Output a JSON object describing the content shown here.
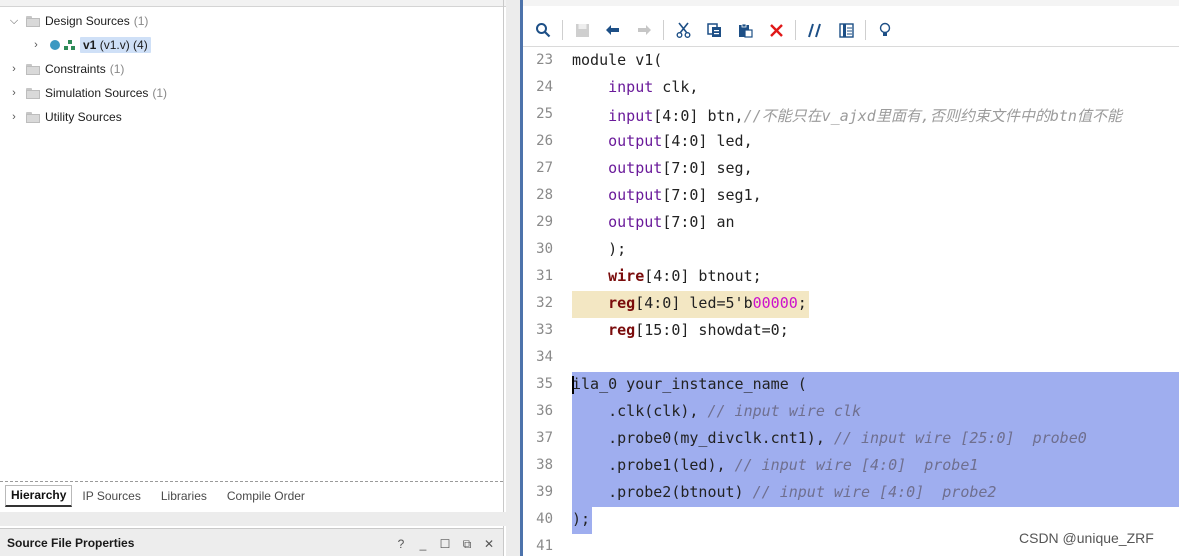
{
  "left_panel": {
    "tree": [
      {
        "label": "Design Sources",
        "count": "(1)",
        "expanded": true
      },
      {
        "label": "v1",
        "detail": "(v1.v) (4)",
        "child": true
      },
      {
        "label": "Constraints",
        "count": "(1)"
      },
      {
        "label": "Simulation Sources",
        "count": "(1)"
      },
      {
        "label": "Utility Sources",
        "count": ""
      }
    ],
    "tabs": [
      "Hierarchy",
      "IP Sources",
      "Libraries",
      "Compile Order"
    ],
    "active_tab": "Hierarchy",
    "properties_title": "Source File Properties",
    "controls": [
      "?",
      "_",
      "☐",
      "⧉",
      "✕"
    ]
  },
  "toolbar": {
    "icons": [
      "search-icon",
      "save-icon",
      "undo-icon",
      "redo-icon",
      "cut-icon",
      "copy-icon",
      "paste-icon",
      "delete-icon",
      "comment-icon",
      "column-icon",
      "bulb-icon"
    ]
  },
  "editor": {
    "lines": [
      {
        "n": "23",
        "segs": [
          [
            "pl",
            "module v1("
          ]
        ]
      },
      {
        "n": "24",
        "segs": [
          [
            "pl",
            "    "
          ],
          [
            "kw",
            "input"
          ],
          [
            "pl",
            " clk,"
          ]
        ]
      },
      {
        "n": "25",
        "segs": [
          [
            "pl",
            "    "
          ],
          [
            "kw",
            "input"
          ],
          [
            "pl",
            "[4:0] btn,"
          ],
          [
            "cmt",
            "//不能只在v_ajxd里面有,否则约束文件中的btn值不能"
          ]
        ]
      },
      {
        "n": "26",
        "segs": [
          [
            "pl",
            "    "
          ],
          [
            "kw",
            "output"
          ],
          [
            "pl",
            "[4:0] led,"
          ]
        ]
      },
      {
        "n": "27",
        "segs": [
          [
            "pl",
            "    "
          ],
          [
            "kw",
            "output"
          ],
          [
            "pl",
            "[7:0] seg,"
          ]
        ]
      },
      {
        "n": "28",
        "segs": [
          [
            "pl",
            "    "
          ],
          [
            "kw",
            "output"
          ],
          [
            "pl",
            "[7:0] seg1,"
          ]
        ]
      },
      {
        "n": "29",
        "segs": [
          [
            "pl",
            "    "
          ],
          [
            "kw",
            "output"
          ],
          [
            "pl",
            "[7:0] an"
          ]
        ]
      },
      {
        "n": "30",
        "segs": [
          [
            "pl",
            "    );"
          ]
        ]
      },
      {
        "n": "31",
        "segs": [
          [
            "pl",
            "    "
          ],
          [
            "kwb",
            "wire"
          ],
          [
            "pl",
            "[4:0] btnout;"
          ]
        ]
      },
      {
        "n": "32",
        "hl": "current",
        "segs": [
          [
            "pl",
            "    "
          ],
          [
            "kwb",
            "reg"
          ],
          [
            "pl",
            "[4:0] led=5'b"
          ],
          [
            "num",
            "00000"
          ],
          [
            "pl",
            ";"
          ]
        ]
      },
      {
        "n": "33",
        "segs": [
          [
            "pl",
            "    "
          ],
          [
            "kwb",
            "reg"
          ],
          [
            "pl",
            "[15:0] showdat=0;"
          ]
        ]
      },
      {
        "n": "34",
        "segs": []
      },
      {
        "n": "35",
        "hl": "selected",
        "caret": true,
        "segs": [
          [
            "pl",
            "ila_0 your_instance_name ("
          ]
        ]
      },
      {
        "n": "36",
        "hl": "selected",
        "segs": [
          [
            "pl",
            "    .clk(clk), "
          ],
          [
            "sel-cmt",
            "// input wire clk"
          ]
        ]
      },
      {
        "n": "37",
        "hl": "selected",
        "segs": [
          [
            "pl",
            "    .probe0(my_divclk.cnt1), "
          ],
          [
            "sel-cmt",
            "// input wire [25:0]  probe0"
          ]
        ]
      },
      {
        "n": "38",
        "hl": "selected",
        "segs": [
          [
            "pl",
            "    .probe1(led), "
          ],
          [
            "sel-cmt",
            "// input wire [4:0]  probe1"
          ]
        ]
      },
      {
        "n": "39",
        "hl": "selected",
        "segs": [
          [
            "pl",
            "    .probe2(btnout) "
          ],
          [
            "sel-cmt",
            "// input wire [4:0]  probe2"
          ]
        ]
      },
      {
        "n": "40",
        "hl": "selected-last",
        "segs": [
          [
            "pl",
            ");"
          ]
        ]
      },
      {
        "n": "41",
        "segs": []
      }
    ]
  },
  "watermark": "CSDN @unique_ZRF"
}
